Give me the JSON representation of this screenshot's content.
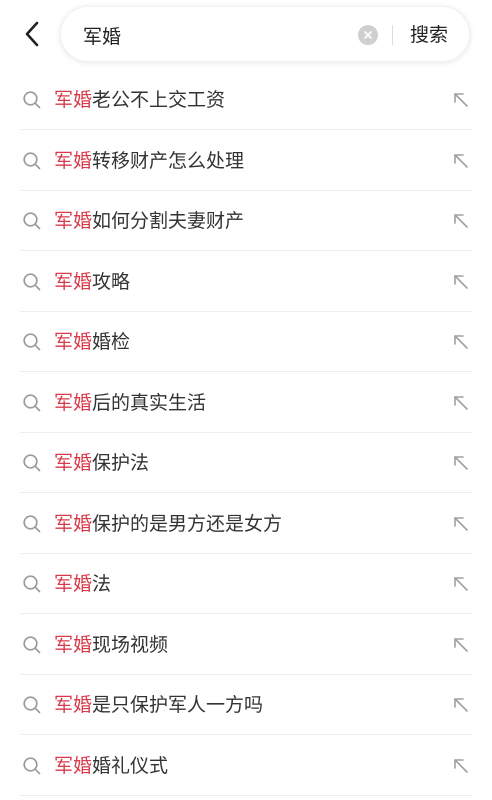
{
  "search": {
    "query": "军婚",
    "button_label": "搜索"
  },
  "colors": {
    "highlight": "#d93a4a",
    "text": "#333333",
    "icon": "#999999"
  },
  "icons": {
    "back": "chevron-left-icon",
    "clear": "clear-circle-icon",
    "row_search": "search-icon",
    "row_fill": "arrow-up-left-icon"
  },
  "suggestions": [
    {
      "prefix": "军婚",
      "suffix": "老公不上交工资"
    },
    {
      "prefix": "军婚",
      "suffix": "转移财产怎么处理"
    },
    {
      "prefix": "军婚",
      "suffix": "如何分割夫妻财产"
    },
    {
      "prefix": "军婚",
      "suffix": "攻略"
    },
    {
      "prefix": "军婚",
      "suffix": "婚检"
    },
    {
      "prefix": "军婚",
      "suffix": "后的真实生活"
    },
    {
      "prefix": "军婚",
      "suffix": "保护法"
    },
    {
      "prefix": "军婚",
      "suffix": "保护的是男方还是女方"
    },
    {
      "prefix": "军婚",
      "suffix": "法"
    },
    {
      "prefix": "军婚",
      "suffix": "现场视频"
    },
    {
      "prefix": "军婚",
      "suffix": "是只保护军人一方吗"
    },
    {
      "prefix": "军婚",
      "suffix": "婚礼仪式"
    }
  ]
}
